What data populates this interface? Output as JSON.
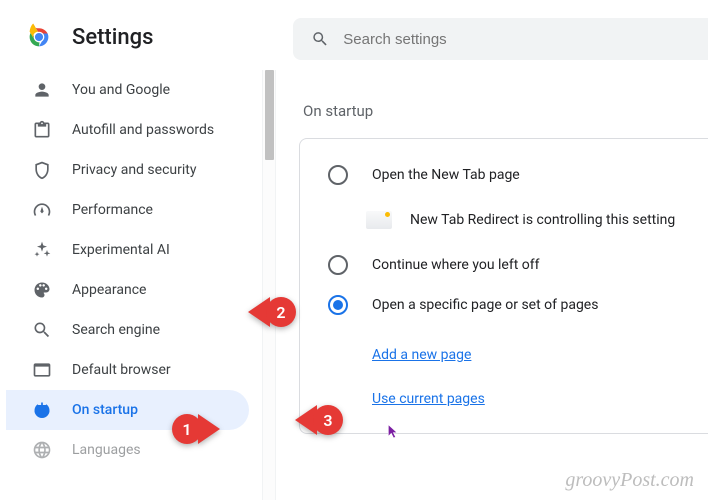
{
  "header": {
    "title": "Settings"
  },
  "search": {
    "placeholder": "Search settings"
  },
  "sidebar": {
    "items": [
      {
        "label": "You and Google"
      },
      {
        "label": "Autofill and passwords"
      },
      {
        "label": "Privacy and security"
      },
      {
        "label": "Performance"
      },
      {
        "label": "Experimental AI"
      },
      {
        "label": "Appearance"
      },
      {
        "label": "Search engine"
      },
      {
        "label": "Default browser"
      },
      {
        "label": "On startup"
      },
      {
        "label": "Languages"
      }
    ]
  },
  "main": {
    "section_title": "On startup",
    "options": [
      {
        "label": "Open the New Tab page"
      },
      {
        "label": "Continue where you left off"
      },
      {
        "label": "Open a specific page or set of pages"
      }
    ],
    "info_text": "New Tab Redirect is controlling this setting",
    "links": {
      "add_page": "Add a new page",
      "use_current": "Use current pages"
    }
  },
  "callouts": {
    "c1": "1",
    "c2": "2",
    "c3": "3"
  },
  "watermark": "groovyPost.com"
}
